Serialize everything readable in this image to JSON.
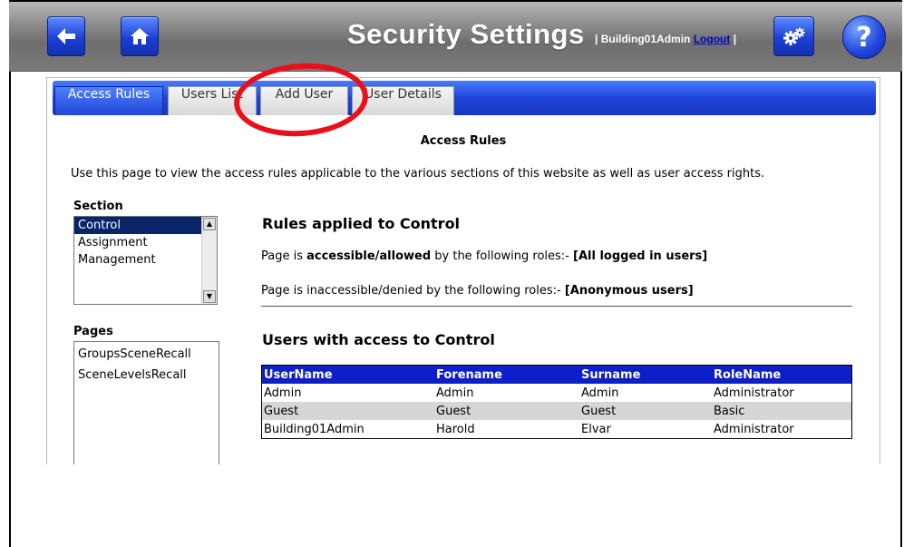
{
  "header": {
    "title": "Security Settings",
    "user_prefix": "| Building01Admin ",
    "logout": "Logout",
    "user_suffix": " |",
    "help_label": "?"
  },
  "tabs": [
    {
      "label": "Access Rules",
      "active": true
    },
    {
      "label": "Users List",
      "active": false
    },
    {
      "label": "Add User",
      "active": false
    },
    {
      "label": "User Details",
      "active": false
    }
  ],
  "page": {
    "heading": "Access Rules",
    "intro": "Use this page to view the access rules applicable to the various sections of this website as well as user access rights."
  },
  "section": {
    "label": "Section",
    "items": [
      "Control",
      "Assignment",
      "Management"
    ],
    "selected": "Control"
  },
  "pages": {
    "label": "Pages",
    "items": [
      "GroupsSceneRecall",
      "SceneLevelsRecall"
    ]
  },
  "rules": {
    "title": "Rules applied to Control",
    "allowed_prefix": "Page is ",
    "allowed_bold": "accessible/allowed",
    "allowed_mid": " by the following roles:- ",
    "allowed_roles": "[All logged in users]",
    "denied_prefix": "Page is inaccessible/denied by the following roles:- ",
    "denied_roles": "[Anonymous users]"
  },
  "users": {
    "title": "Users with access to Control",
    "columns": [
      "UserName",
      "Forename",
      "Surname",
      "RoleName"
    ],
    "rows": [
      [
        "Admin",
        "Admin",
        "Admin",
        "Administrator"
      ],
      [
        "Guest",
        "Guest",
        "Guest",
        "Basic"
      ],
      [
        "Building01Admin",
        "Harold",
        "Elvar",
        "Administrator"
      ]
    ]
  },
  "colors": {
    "accent_blue": "#1f45d8",
    "table_header": "#0d1fc9",
    "annotation_red": "#e8101a",
    "selection": "#0a246a"
  },
  "icons": [
    "back-arrow-icon",
    "home-icon",
    "gears-icon",
    "help-icon"
  ]
}
